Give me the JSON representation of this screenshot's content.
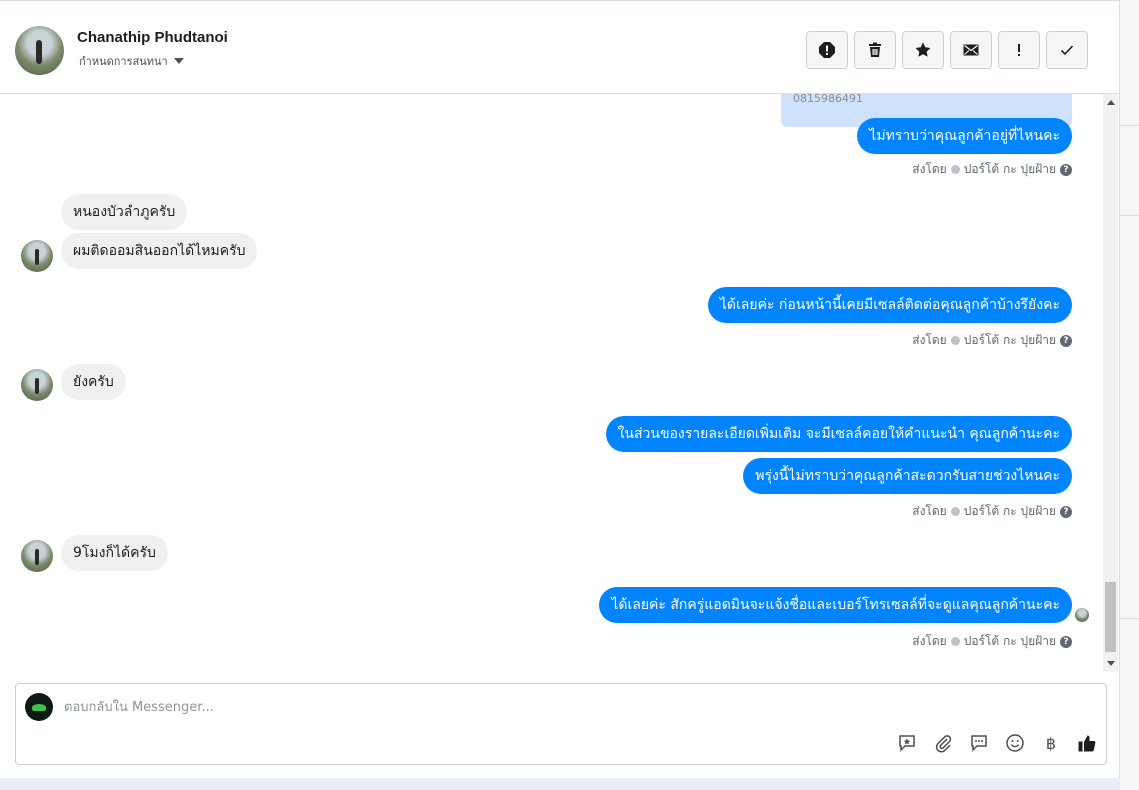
{
  "header": {
    "name": "Chanathip Phudtanoi",
    "subtitle": "กำหนดการสนทนา"
  },
  "toolbar": {
    "buttons": [
      {
        "icon": "spam-alert-icon"
      },
      {
        "icon": "trash-icon"
      },
      {
        "icon": "star-icon"
      },
      {
        "icon": "mail-icon"
      },
      {
        "icon": "exclamation-icon"
      },
      {
        "icon": "check-icon"
      }
    ]
  },
  "messages": {
    "card_phone": "0815986491",
    "out1": "ไม่ทราบว่าคุณลูกค้าอยู่ที่ไหนคะ",
    "in1": "หนองบัวลำภูครับ",
    "in2": "ผมติดออมสินออกได้ไหมครับ",
    "out2": "ได้เลยค่ะ ก่อนหน้านี้เคยมีเซลล์ติดต่อคุณลูกค้าบ้างรึยังคะ",
    "in3": "ยังครับ",
    "out3": "ในส่วนของรายละเอียดเพิ่มเติม จะมีเซลล์คอยให้คำแนะนำ คุณลูกค้านะคะ",
    "out4": "พรุ่งนี้ไม่ทราบว่าคุณลูกค้าสะดวกรับสายช่วงไหนคะ",
    "in4": "9โมงก็ได้ครับ",
    "out5": "ได้เลยค่ะ สักครู่แอดมินจะแจ้งชื่อและเบอร์โทรเซลล์ที่จะดูแลคุณลูกค้านะคะ",
    "status_sent": "ส่งโดย",
    "status_sender": "ปอร์โต้ กะ ปุยฝ้าย",
    "status_q": "?"
  },
  "composer": {
    "placeholder": "ตอบกลับใน Messenger...",
    "baht_symbol": "฿"
  }
}
